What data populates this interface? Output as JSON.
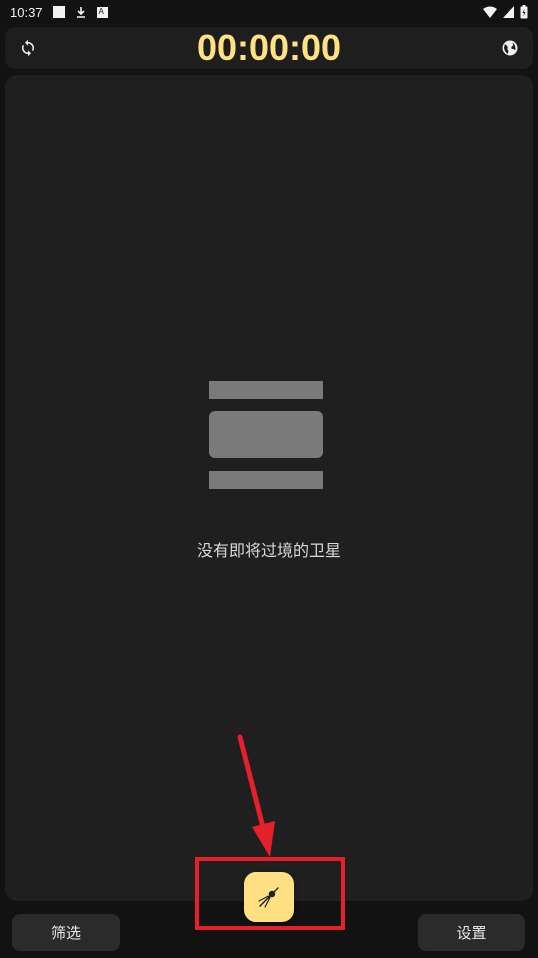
{
  "status_bar": {
    "time": "10:37"
  },
  "header": {
    "timer": "00:00:00",
    "left_icon": "refresh-icon",
    "right_icon": "globe-icon",
    "accent_color": "#ffe082"
  },
  "main": {
    "empty_message": "没有即将过境的卫星",
    "illustration_icon": "empty-list-icon"
  },
  "bottom_bar": {
    "filter_label": "筛选",
    "settings_label": "设置",
    "fab_icon": "satellite-icon"
  },
  "annotation": {
    "color": "#e5202a",
    "target": "satellite-fab"
  }
}
